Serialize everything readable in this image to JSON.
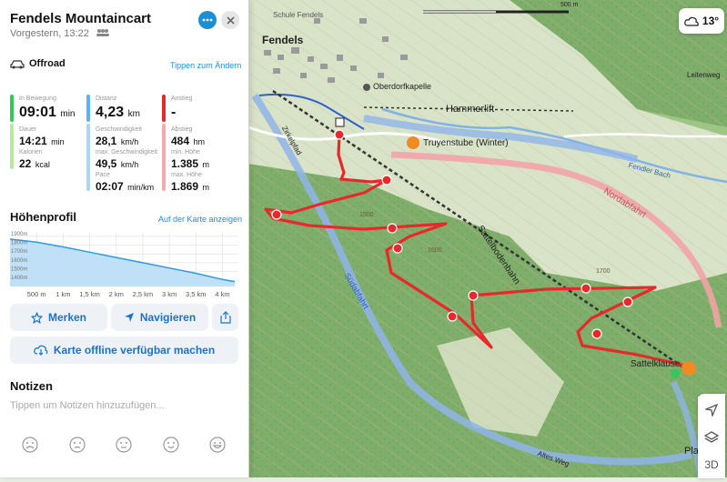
{
  "route": {
    "title": "Fendels Mountaincart",
    "subtitle": "Vorgestern, 13:22",
    "activity": "Offroad",
    "change_tips": "Tippen zum Ändern"
  },
  "stats": {
    "moving": {
      "label": "In Bewegung",
      "value": "09:01",
      "unit": "min",
      "duration_label": "Dauer",
      "duration_value": "14:21",
      "duration_unit": "min",
      "calories_label": "Kalorien",
      "calories_value": "22",
      "calories_unit": "kcal"
    },
    "distance": {
      "label": "Distanz",
      "value": "4,23",
      "unit": "km",
      "speed_label": "Geschwindigkeit",
      "speed_value": "28,1",
      "speed_unit": "km/h",
      "maxspeed_label": "max. Geschwindigkeit",
      "maxspeed_value": "49,5",
      "maxspeed_unit": "km/h",
      "pace_label": "Pace",
      "pace_value": "02:07",
      "pace_unit": "min/km"
    },
    "ascent": {
      "label": "Anstieg",
      "value": "-",
      "descent_label": "Abstieg",
      "descent_value": "484",
      "descent_unit": "hm",
      "minh_label": "min. Höhe",
      "minh_value": "1.385",
      "minh_unit": "m",
      "maxh_label": "max. Höhe",
      "maxh_value": "1.869",
      "maxh_unit": "m"
    },
    "colors": {
      "moving": "#34c759",
      "distance": "#5ab4f0",
      "ascent": "#e8292b"
    }
  },
  "profile": {
    "title": "Höhenprofil",
    "show_on_map": "Auf der Karte anzeigen",
    "y_ticks": [
      "1900m",
      "1800m",
      "1700m",
      "1600m",
      "1500m",
      "1400m"
    ],
    "x_ticks": [
      "500 m",
      "1 km",
      "1,5 km",
      "2 km",
      "2,5 km",
      "3 km",
      "3,5 km",
      "4 km"
    ]
  },
  "chart_data": {
    "type": "area",
    "x": [
      0,
      0.5,
      1,
      1.5,
      2,
      2.5,
      3,
      3.5,
      4,
      4.23
    ],
    "values": [
      1869,
      1835,
      1780,
      1720,
      1660,
      1600,
      1540,
      1480,
      1410,
      1385
    ],
    "xlabel": "",
    "ylabel": "",
    "ylim": [
      1330,
      1940
    ],
    "xlim": [
      0,
      4.3
    ],
    "grid": true
  },
  "actions": {
    "bookmark": "Merken",
    "navigate": "Navigieren",
    "offline": "Karte offline verfügbar machen"
  },
  "notes": {
    "title": "Notizen",
    "placeholder": "Tippen um Notizen hinzuzufügen..."
  },
  "map": {
    "temperature": "13°",
    "scale": "500 m",
    "three_d": "3D",
    "labels": {
      "fendels": "Fendels",
      "oberdorfkapelle": "Oberdorfkapelle",
      "hammerlift": "Hammerlift",
      "truyenstube": "Truyenstube (Winter)",
      "sattelbodenbahn": "Sattelbodenbahn",
      "nordabfahrt": "Nordabfahrt",
      "suedabfahrt": "Südabfahrt",
      "sattelklause": "Sattelklause",
      "fendler_bach": "Fendler Bach",
      "zirkelpfad": "Zirkelpfad",
      "leitenweg": "Leitenweg",
      "altes_weg": "Altes Weg",
      "plan": "Plan",
      "schule": "Schule Fendels",
      "alt_1500": "1500",
      "alt_1600": "1600",
      "alt_1700": "1700"
    }
  }
}
